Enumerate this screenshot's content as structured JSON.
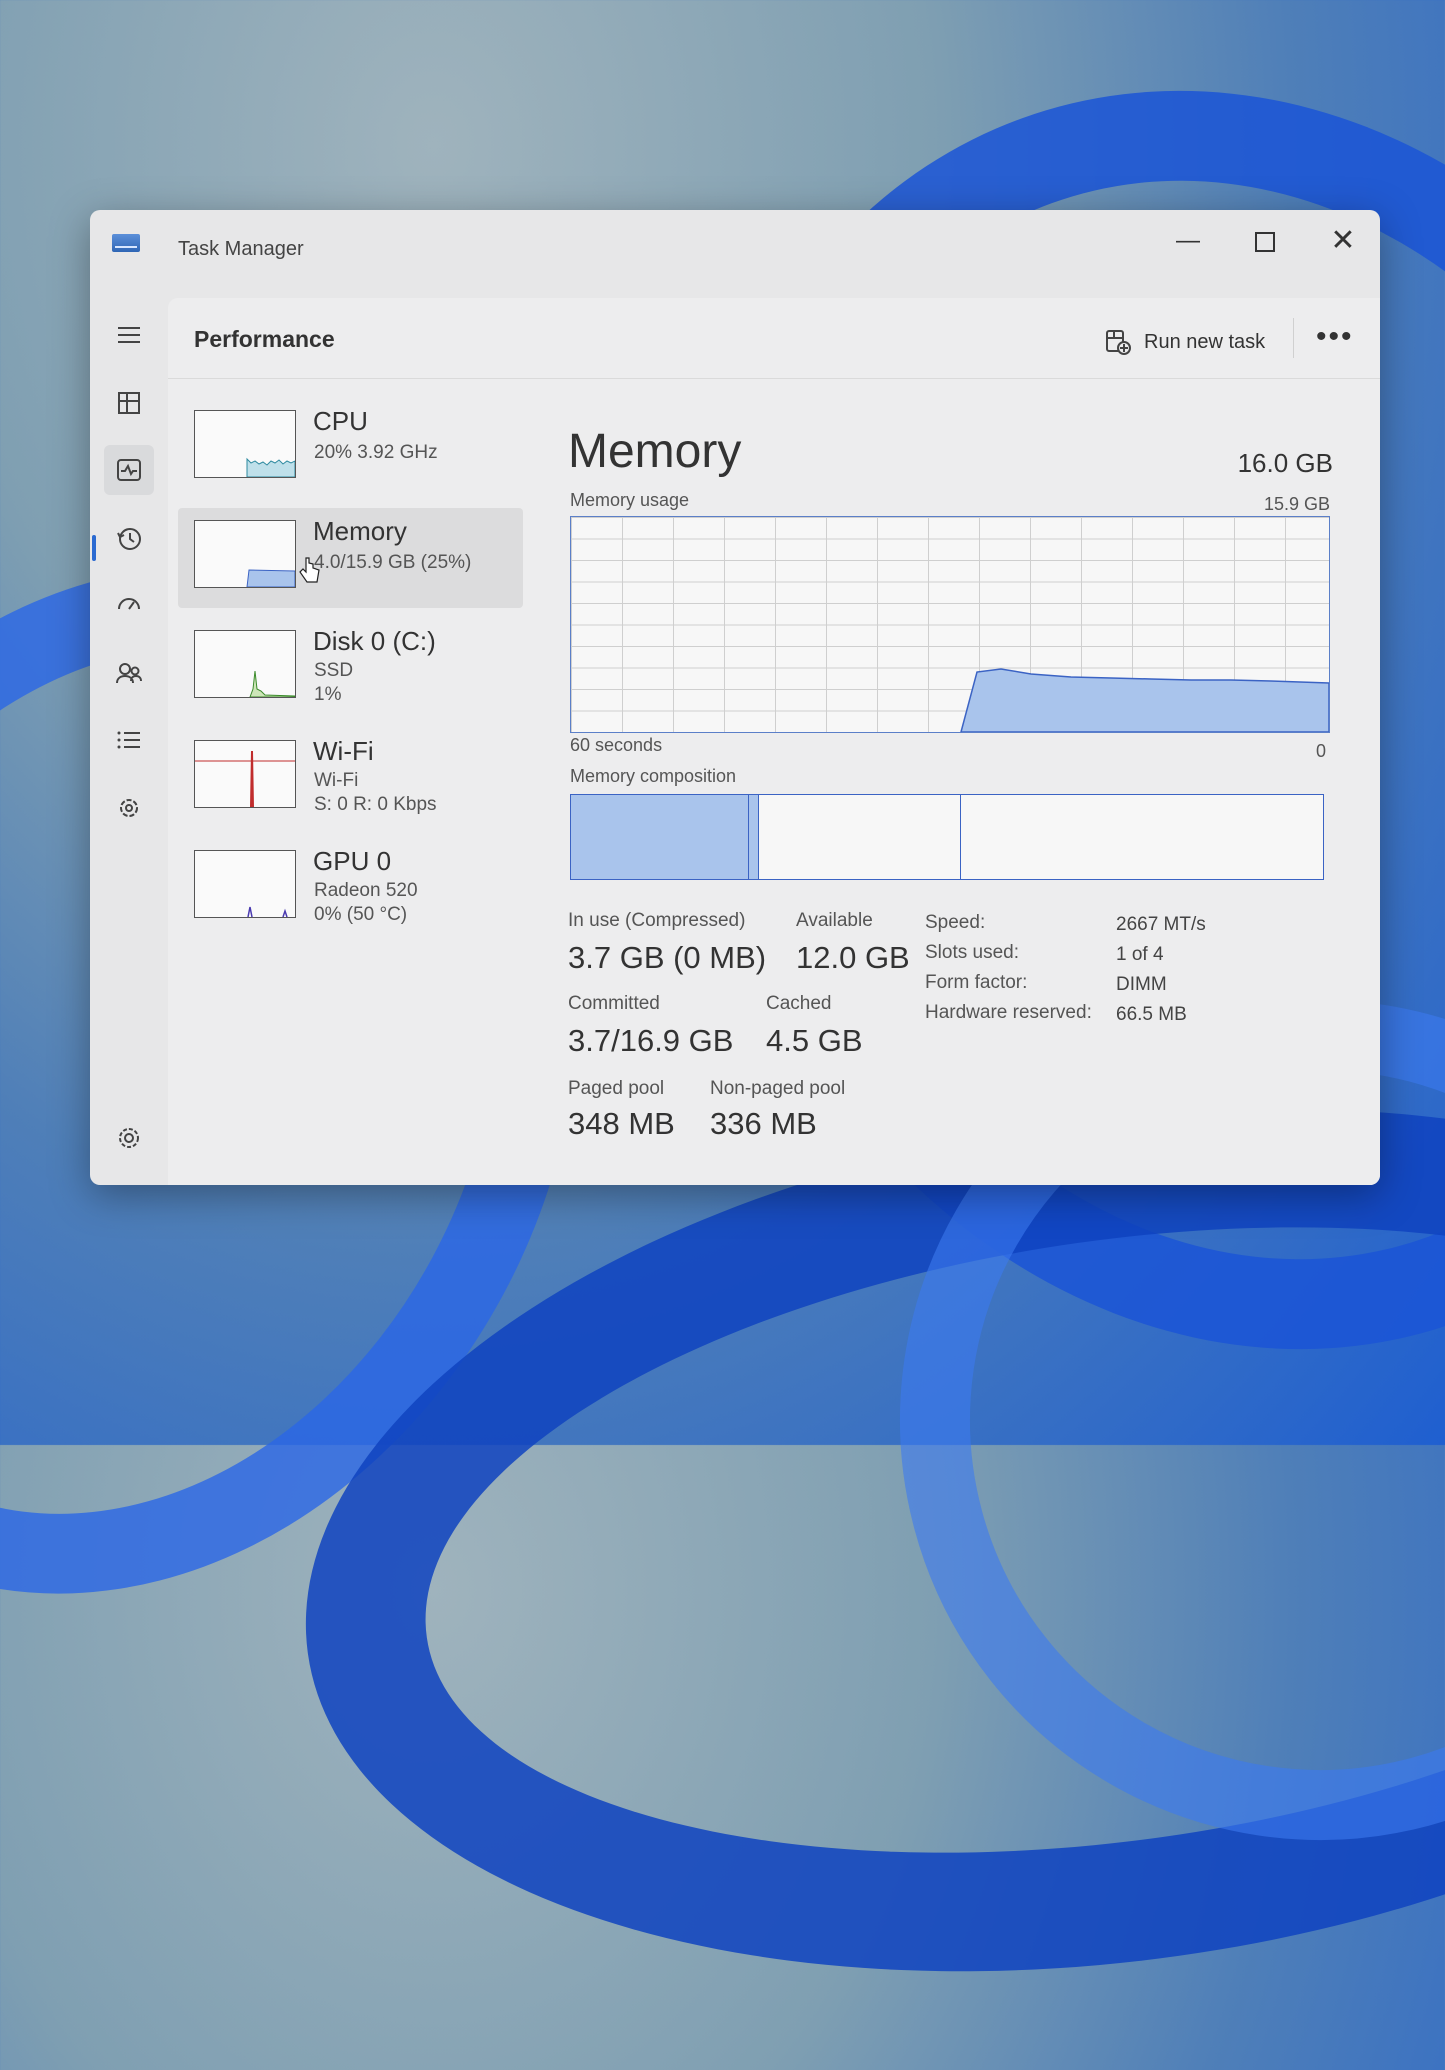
{
  "window": {
    "title": "Task Manager"
  },
  "page_title": "Performance",
  "toolbar": {
    "run_new_task": "Run new task",
    "more": "•••"
  },
  "nav": [
    {
      "icon": "hamburger-icon"
    },
    {
      "icon": "processes-icon"
    },
    {
      "icon": "performance-icon",
      "active": true
    },
    {
      "icon": "app-history-icon"
    },
    {
      "icon": "startup-apps-icon"
    },
    {
      "icon": "users-icon"
    },
    {
      "icon": "details-icon"
    },
    {
      "icon": "services-icon"
    },
    {
      "icon": "settings-icon"
    }
  ],
  "devices": [
    {
      "name": "CPU",
      "line1": "20%  3.92 GHz",
      "line2": ""
    },
    {
      "name": "Memory",
      "line1": "4.0/15.9 GB (25%)",
      "line2": ""
    },
    {
      "name": "Disk 0 (C:)",
      "line1": "SSD",
      "line2": "1%"
    },
    {
      "name": "Wi-Fi",
      "line1": "Wi-Fi",
      "line2": "S: 0 R: 0 Kbps"
    },
    {
      "name": "GPU 0",
      "line1": "Radeon 520",
      "line2": "0% (50 °C)"
    }
  ],
  "memory": {
    "title": "Memory",
    "total": "16.0 GB",
    "usage_label": "Memory usage",
    "usage_max": "15.9 GB",
    "time_label": "60 seconds",
    "zero_label": "0",
    "composition_label": "Memory composition",
    "stats": {
      "in_use_label": "In use (Compressed)",
      "in_use": "3.7 GB (0 MB)",
      "available_label": "Available",
      "available": "12.0 GB",
      "committed_label": "Committed",
      "committed": "3.7/16.9 GB",
      "cached_label": "Cached",
      "cached": "4.5 GB",
      "paged_label": "Paged pool",
      "paged": "348 MB",
      "nonpaged_label": "Non-paged pool",
      "nonpaged": "336 MB"
    },
    "props": {
      "speed_label": "Speed:",
      "speed": "2667 MT/s",
      "slots_label": "Slots used:",
      "slots": "1 of 4",
      "form_label": "Form factor:",
      "form": "DIMM",
      "hw_label": "Hardware reserved:",
      "hw": "66.5 MB"
    }
  },
  "colors": {
    "accent": "#2b6ad1",
    "memory_fill": "#a9c4ec",
    "memory_line": "#3b63c4"
  }
}
